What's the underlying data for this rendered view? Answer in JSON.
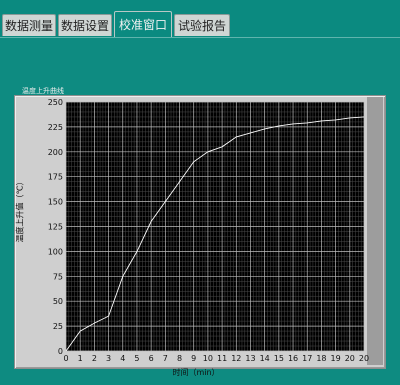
{
  "tabs": [
    {
      "label": "数据测量",
      "active": false
    },
    {
      "label": "数据设置",
      "active": false
    },
    {
      "label": "校准窗口",
      "active": true
    },
    {
      "label": "试验报告",
      "active": false
    }
  ],
  "chart_data": {
    "type": "line",
    "title": "温度上升曲线",
    "xlabel": "时间（min）",
    "ylabel": "温度上升值（℃）",
    "x_tick_labels": [
      "0",
      "1",
      "2",
      "3",
      "4",
      "5",
      "6",
      "7",
      "8",
      "9",
      "10",
      "11",
      "12",
      "13",
      "14",
      "15",
      "16",
      "17",
      "18",
      "19",
      "20",
      "20"
    ],
    "y_ticks": [
      0,
      25,
      50,
      75,
      100,
      125,
      150,
      175,
      200,
      225,
      250
    ],
    "ylim": [
      0,
      250
    ],
    "grid": true,
    "series": [
      {
        "x": [
          0,
          1,
          2,
          3,
          4,
          5,
          6,
          7,
          8,
          9,
          10,
          11,
          12,
          13,
          14,
          15,
          16,
          17,
          18,
          19,
          20,
          21
        ],
        "y": [
          0,
          20,
          28,
          35,
          75,
          100,
          130,
          150,
          170,
          190,
          200,
          205,
          215,
          219,
          223,
          226,
          228,
          229,
          231,
          232,
          234,
          235
        ],
        "color": "#ffffff"
      }
    ],
    "colors": {
      "plot_bg": "#000000",
      "major_grid": "#bdbdbd",
      "minor_grid": "#4a4a4a"
    }
  }
}
